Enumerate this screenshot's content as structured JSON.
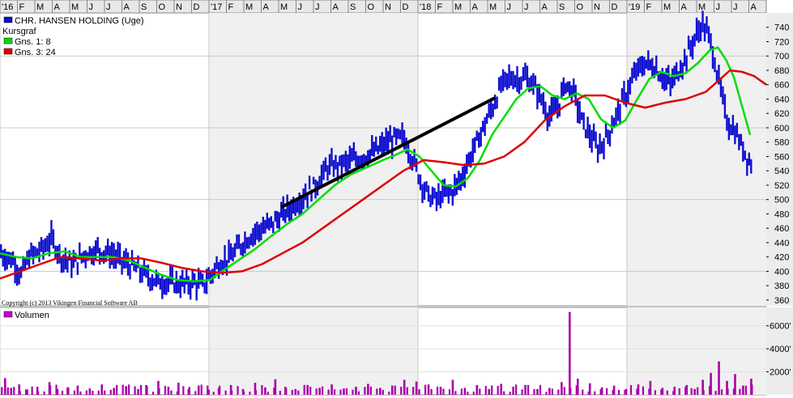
{
  "chart_data": {
    "type": "bar",
    "title": "CHR. HANSEN HOLDING (Uge)",
    "legend": [
      {
        "name": "Kursgraf",
        "color": ""
      },
      {
        "name": "Gns. 1: 8",
        "color": "#00dd00"
      },
      {
        "name": "Gns. 3: 24",
        "color": "#dd0000"
      }
    ],
    "legend_placement": "top-left",
    "copyright": "Copyright (c) 2013 Vikingen Financial Software AB",
    "volume_label": "Volumen",
    "month_labels": [
      "'16",
      "F",
      "M",
      "A",
      "M",
      "J",
      "J",
      "A",
      "S",
      "O",
      "N",
      "D",
      "'17",
      "F",
      "M",
      "A",
      "M",
      "J",
      "J",
      "A",
      "S",
      "O",
      "N",
      "D",
      "'18",
      "F",
      "M",
      "A",
      "M",
      "J",
      "J",
      "A",
      "S",
      "O",
      "N",
      "D",
      "'19",
      "F",
      "M",
      "A",
      "M",
      "J",
      "J",
      "A"
    ],
    "price_ticks": [
      360,
      380,
      400,
      420,
      440,
      460,
      480,
      500,
      520,
      540,
      560,
      580,
      600,
      620,
      640,
      660,
      680,
      700,
      720,
      740
    ],
    "price_ylim": [
      352,
      760
    ],
    "volume_ticks": [
      "2000'",
      "4000'",
      "6000'"
    ],
    "volume_tick_values": [
      2000,
      4000,
      6000
    ],
    "volume_ylim": [
      0,
      7600
    ],
    "grid": true,
    "trendline": {
      "from": {
        "week": 140,
        "value": 490
      },
      "to": {
        "week": 245,
        "value": 641
      }
    },
    "series": [
      {
        "name": "Kursgraf",
        "points": [
          [
            0,
            425
          ],
          [
            6,
            415
          ],
          [
            10,
            395
          ],
          [
            14,
            420
          ],
          [
            20,
            430
          ],
          [
            25,
            445
          ],
          [
            30,
            420
          ],
          [
            36,
            410
          ],
          [
            42,
            425
          ],
          [
            48,
            430
          ],
          [
            54,
            425
          ],
          [
            60,
            415
          ],
          [
            66,
            405
          ],
          [
            72,
            395
          ],
          [
            78,
            385
          ],
          [
            84,
            385
          ],
          [
            90,
            382
          ],
          [
            96,
            385
          ],
          [
            100,
            380
          ],
          [
            104,
            395
          ],
          [
            108,
            410
          ],
          [
            114,
            420
          ],
          [
            120,
            440
          ],
          [
            126,
            455
          ],
          [
            132,
            462
          ],
          [
            138,
            475
          ],
          [
            144,
            490
          ],
          [
            150,
            505
          ],
          [
            156,
            520
          ],
          [
            162,
            545
          ],
          [
            168,
            548
          ],
          [
            174,
            555
          ],
          [
            180,
            560
          ],
          [
            186,
            568
          ],
          [
            192,
            580
          ],
          [
            196,
            585
          ],
          [
            200,
            585
          ],
          [
            204,
            558
          ],
          [
            208,
            528
          ],
          [
            212,
            505
          ],
          [
            216,
            500
          ],
          [
            220,
            508
          ],
          [
            224,
            512
          ],
          [
            228,
            528
          ],
          [
            232,
            555
          ],
          [
            236,
            580
          ],
          [
            240,
            605
          ],
          [
            244,
            630
          ],
          [
            248,
            658
          ],
          [
            252,
            670
          ],
          [
            256,
            668
          ],
          [
            260,
            670
          ],
          [
            264,
            660
          ],
          [
            268,
            640
          ],
          [
            272,
            615
          ],
          [
            276,
            628
          ],
          [
            280,
            662
          ],
          [
            284,
            650
          ],
          [
            288,
            610
          ],
          [
            292,
            590
          ],
          [
            296,
            570
          ],
          [
            300,
            585
          ],
          [
            304,
            610
          ],
          [
            308,
            635
          ],
          [
            312,
            660
          ],
          [
            316,
            682
          ],
          [
            320,
            690
          ],
          [
            324,
            685
          ],
          [
            328,
            672
          ],
          [
            332,
            660
          ],
          [
            336,
            680
          ],
          [
            340,
            700
          ],
          [
            344,
            725
          ],
          [
            348,
            745
          ],
          [
            352,
            720
          ],
          [
            356,
            665
          ],
          [
            360,
            610
          ],
          [
            364,
            595
          ],
          [
            368,
            570
          ],
          [
            372,
            550
          ]
        ]
      },
      {
        "name": "Gns. 1: 8",
        "points": [
          [
            0,
            425
          ],
          [
            8,
            420
          ],
          [
            16,
            418
          ],
          [
            24,
            425
          ],
          [
            32,
            428
          ],
          [
            40,
            420
          ],
          [
            48,
            420
          ],
          [
            56,
            420
          ],
          [
            64,
            415
          ],
          [
            72,
            405
          ],
          [
            80,
            395
          ],
          [
            88,
            388
          ],
          [
            96,
            386
          ],
          [
            104,
            388
          ],
          [
            110,
            400
          ],
          [
            118,
            415
          ],
          [
            126,
            430
          ],
          [
            134,
            448
          ],
          [
            142,
            465
          ],
          [
            150,
            480
          ],
          [
            158,
            500
          ],
          [
            166,
            520
          ],
          [
            174,
            535
          ],
          [
            182,
            545
          ],
          [
            190,
            555
          ],
          [
            196,
            562
          ],
          [
            202,
            570
          ],
          [
            208,
            560
          ],
          [
            214,
            540
          ],
          [
            220,
            520
          ],
          [
            226,
            518
          ],
          [
            232,
            530
          ],
          [
            238,
            555
          ],
          [
            244,
            590
          ],
          [
            250,
            615
          ],
          [
            256,
            640
          ],
          [
            262,
            655
          ],
          [
            268,
            658
          ],
          [
            274,
            645
          ],
          [
            280,
            640
          ],
          [
            286,
            648
          ],
          [
            292,
            640
          ],
          [
            298,
            612
          ],
          [
            304,
            600
          ],
          [
            310,
            610
          ],
          [
            316,
            640
          ],
          [
            322,
            668
          ],
          [
            328,
            678
          ],
          [
            334,
            672
          ],
          [
            340,
            676
          ],
          [
            346,
            690
          ],
          [
            352,
            708
          ],
          [
            356,
            712
          ],
          [
            360,
            695
          ],
          [
            364,
            670
          ],
          [
            368,
            630
          ],
          [
            372,
            590
          ]
        ]
      },
      {
        "name": "Gns. 3: 24",
        "points": [
          [
            0,
            390
          ],
          [
            10,
            400
          ],
          [
            20,
            410
          ],
          [
            30,
            420
          ],
          [
            40,
            418
          ],
          [
            50,
            415
          ],
          [
            60,
            418
          ],
          [
            70,
            418
          ],
          [
            80,
            412
          ],
          [
            90,
            405
          ],
          [
            100,
            400
          ],
          [
            110,
            398
          ],
          [
            120,
            400
          ],
          [
            130,
            410
          ],
          [
            140,
            425
          ],
          [
            150,
            440
          ],
          [
            160,
            460
          ],
          [
            170,
            480
          ],
          [
            180,
            500
          ],
          [
            190,
            520
          ],
          [
            200,
            540
          ],
          [
            210,
            555
          ],
          [
            220,
            552
          ],
          [
            230,
            548
          ],
          [
            240,
            550
          ],
          [
            250,
            560
          ],
          [
            260,
            580
          ],
          [
            270,
            610
          ],
          [
            280,
            630
          ],
          [
            290,
            645
          ],
          [
            300,
            645
          ],
          [
            310,
            635
          ],
          [
            320,
            628
          ],
          [
            330,
            635
          ],
          [
            340,
            640
          ],
          [
            350,
            650
          ],
          [
            356,
            665
          ],
          [
            362,
            680
          ],
          [
            368,
            678
          ],
          [
            374,
            672
          ],
          [
            380,
            660
          ]
        ]
      }
    ],
    "volume": [
      {
        "week": 2,
        "value": 1450
      },
      {
        "week": 5,
        "value": 600
      },
      {
        "week": 9,
        "value": 900
      },
      {
        "week": 13,
        "value": 450
      },
      {
        "week": 18,
        "value": 700
      },
      {
        "week": 24,
        "value": 1100
      },
      {
        "week": 28,
        "value": 500
      },
      {
        "week": 33,
        "value": 650
      },
      {
        "week": 38,
        "value": 800
      },
      {
        "week": 44,
        "value": 550
      },
      {
        "week": 50,
        "value": 900
      },
      {
        "week": 56,
        "value": 600
      },
      {
        "week": 62,
        "value": 750
      },
      {
        "week": 68,
        "value": 500
      },
      {
        "week": 72,
        "value": 850
      },
      {
        "week": 78,
        "value": 1200
      },
      {
        "week": 83,
        "value": 700
      },
      {
        "week": 88,
        "value": 1050
      },
      {
        "week": 93,
        "value": 500
      },
      {
        "week": 98,
        "value": 800
      },
      {
        "week": 103,
        "value": 450
      },
      {
        "week": 108,
        "value": 600
      },
      {
        "week": 114,
        "value": 850
      },
      {
        "week": 120,
        "value": 500
      },
      {
        "week": 126,
        "value": 1050
      },
      {
        "week": 131,
        "value": 650
      },
      {
        "week": 136,
        "value": 1350
      },
      {
        "week": 141,
        "value": 700
      },
      {
        "week": 146,
        "value": 500
      },
      {
        "week": 152,
        "value": 850
      },
      {
        "week": 158,
        "value": 600
      },
      {
        "week": 164,
        "value": 900
      },
      {
        "week": 170,
        "value": 550
      },
      {
        "week": 176,
        "value": 700
      },
      {
        "week": 182,
        "value": 950
      },
      {
        "week": 188,
        "value": 600
      },
      {
        "week": 194,
        "value": 800
      },
      {
        "week": 200,
        "value": 1300
      },
      {
        "week": 206,
        "value": 1150
      },
      {
        "week": 212,
        "value": 900
      },
      {
        "week": 218,
        "value": 700
      },
      {
        "week": 224,
        "value": 1300
      },
      {
        "week": 230,
        "value": 600
      },
      {
        "week": 236,
        "value": 850
      },
      {
        "week": 242,
        "value": 500
      },
      {
        "week": 248,
        "value": 950
      },
      {
        "week": 254,
        "value": 700
      },
      {
        "week": 260,
        "value": 850
      },
      {
        "week": 266,
        "value": 500
      },
      {
        "week": 272,
        "value": 600
      },
      {
        "week": 278,
        "value": 1100
      },
      {
        "week": 282,
        "value": 7200
      },
      {
        "week": 286,
        "value": 1400
      },
      {
        "week": 292,
        "value": 1000
      },
      {
        "week": 298,
        "value": 650
      },
      {
        "week": 304,
        "value": 800
      },
      {
        "week": 310,
        "value": 500
      },
      {
        "week": 316,
        "value": 900
      },
      {
        "week": 322,
        "value": 1200
      },
      {
        "week": 328,
        "value": 600
      },
      {
        "week": 334,
        "value": 700
      },
      {
        "week": 340,
        "value": 850
      },
      {
        "week": 344,
        "value": 500
      },
      {
        "week": 348,
        "value": 1300
      },
      {
        "week": 352,
        "value": 1900
      },
      {
        "week": 356,
        "value": 2900
      },
      {
        "week": 360,
        "value": 1200
      },
      {
        "week": 364,
        "value": 1800
      },
      {
        "week": 368,
        "value": 800
      },
      {
        "week": 372,
        "value": 1400
      }
    ]
  }
}
